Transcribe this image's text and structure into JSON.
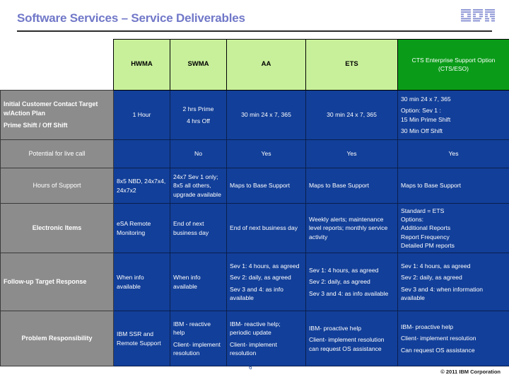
{
  "slide": {
    "title": "Software Services – Service Deliverables",
    "title_color": "#7178c8",
    "logo_name": "ibm-logo",
    "page_number": "6",
    "copyright": "© 2011 IBM Corporation"
  },
  "table": {
    "corner_label": "",
    "columns": [
      {
        "label": "HWMA",
        "highlight": false
      },
      {
        "label": "SWMA",
        "highlight": false
      },
      {
        "label": "AA",
        "highlight": false
      },
      {
        "label": "ETS",
        "highlight": false
      },
      {
        "label": "CTS Enterprise Support Option (CTS/ESO)",
        "highlight": true
      }
    ],
    "accent_header": "#c8f09a",
    "accent_header_highlight": "#0a9c18",
    "accent_row_label": "#8c8c8c",
    "accent_data_cell": "#123f99",
    "rows": [
      {
        "label_lines": [
          "Initial Customer Contact Target w/Action Plan",
          "Prime Shift / Off Shift"
        ],
        "label_bold": true,
        "label_align": "left",
        "cells": [
          {
            "lines": [
              "1 Hour"
            ],
            "align": "center"
          },
          {
            "lines": [
              "2 hrs Prime",
              "4 hrs Off"
            ],
            "align": "center"
          },
          {
            "lines": [
              "30 min 24 x 7, 365"
            ],
            "align": "center"
          },
          {
            "lines": [
              "30 min 24 x 7, 365"
            ],
            "align": "center"
          },
          {
            "lines": [
              "30 min 24 x 7, 365",
              "Option: Sev 1 :\n15 Min Prime Shift",
              "30 Min Off  Shift"
            ],
            "align": "left"
          }
        ]
      },
      {
        "label_lines": [
          "Potential for live call"
        ],
        "label_bold": false,
        "label_align": "center",
        "cells": [
          {
            "lines": [
              ""
            ],
            "align": "center"
          },
          {
            "lines": [
              "No"
            ],
            "align": "center"
          },
          {
            "lines": [
              "Yes"
            ],
            "align": "center"
          },
          {
            "lines": [
              "Yes"
            ],
            "align": "center"
          },
          {
            "lines": [
              "Yes"
            ],
            "align": "center"
          }
        ]
      },
      {
        "label_lines": [
          "Hours of  Support"
        ],
        "label_bold": false,
        "label_align": "center",
        "cells": [
          {
            "lines": [
              "8x5 NBD, 24x7x4, 24x7x2"
            ],
            "align": "left",
            "tight": true
          },
          {
            "lines": [
              "24x7 Sev 1 only; 8x5 all others, upgrade available"
            ],
            "align": "left",
            "tight": true
          },
          {
            "lines": [
              "Maps to Base Support"
            ],
            "align": "left"
          },
          {
            "lines": [
              "Maps to Base Support"
            ],
            "align": "left"
          },
          {
            "lines": [
              "Maps to Base Support"
            ],
            "align": "left"
          }
        ]
      },
      {
        "label_lines": [
          "Electronic Items"
        ],
        "label_bold": true,
        "label_align": "center",
        "cells": [
          {
            "lines": [
              "eSA Remote Monitoring"
            ],
            "align": "left",
            "tight": true
          },
          {
            "lines": [
              "End of next business day"
            ],
            "align": "left",
            "tight": true
          },
          {
            "lines": [
              "End of next business day"
            ],
            "align": "left",
            "tight": true
          },
          {
            "lines": [
              "Weekly alerts; maintenance level reports; monthly service activity"
            ],
            "align": "left",
            "tight": true
          },
          {
            "lines": [
              "Standard = ETS\nOptions:\nAdditional Reports\nReport Frequency\nDetailed PM reports"
            ],
            "align": "left",
            "tight": true
          }
        ]
      },
      {
        "label_lines": [
          "Follow-up Target Response"
        ],
        "label_bold": true,
        "label_align": "left",
        "cells": [
          {
            "lines": [
              "When info available"
            ],
            "align": "left",
            "tight": true
          },
          {
            "lines": [
              "When info available"
            ],
            "align": "left",
            "tight": true
          },
          {
            "lines": [
              "Sev 1: 4 hours, as agreed",
              "Sev 2: daily, as agreed",
              "Sev 3 and 4: as info available"
            ],
            "align": "left"
          },
          {
            "lines": [
              "Sev 1: 4 hours, as agreed",
              "Sev 2: daily, as agreed",
              "Sev 3 and 4: as info available"
            ],
            "align": "left"
          },
          {
            "lines": [
              "Sev 1: 4 hours, as agreed",
              "Sev 2: daily, as agreed",
              "Sev 3 and 4: when information available"
            ],
            "align": "left"
          }
        ]
      },
      {
        "label_lines": [
          "Problem Responsibility"
        ],
        "label_bold": true,
        "label_align": "center",
        "cells": [
          {
            "lines": [
              "IBM SSR and Remote Support"
            ],
            "align": "left",
            "tight": true
          },
          {
            "lines": [
              "IBM - reactive help",
              "Client- implement resolution"
            ],
            "align": "left"
          },
          {
            "lines": [
              "IBM- reactive help; periodic update",
              "Client- implement resolution"
            ],
            "align": "left"
          },
          {
            "lines": [
              "IBM- proactive help",
              "Client- implement resolution can request OS assistance"
            ],
            "align": "left"
          },
          {
            "lines": [
              "IBM- proactive help",
              "Client- implement resolution",
              "Can request OS assistance"
            ],
            "align": "left"
          }
        ]
      }
    ]
  }
}
